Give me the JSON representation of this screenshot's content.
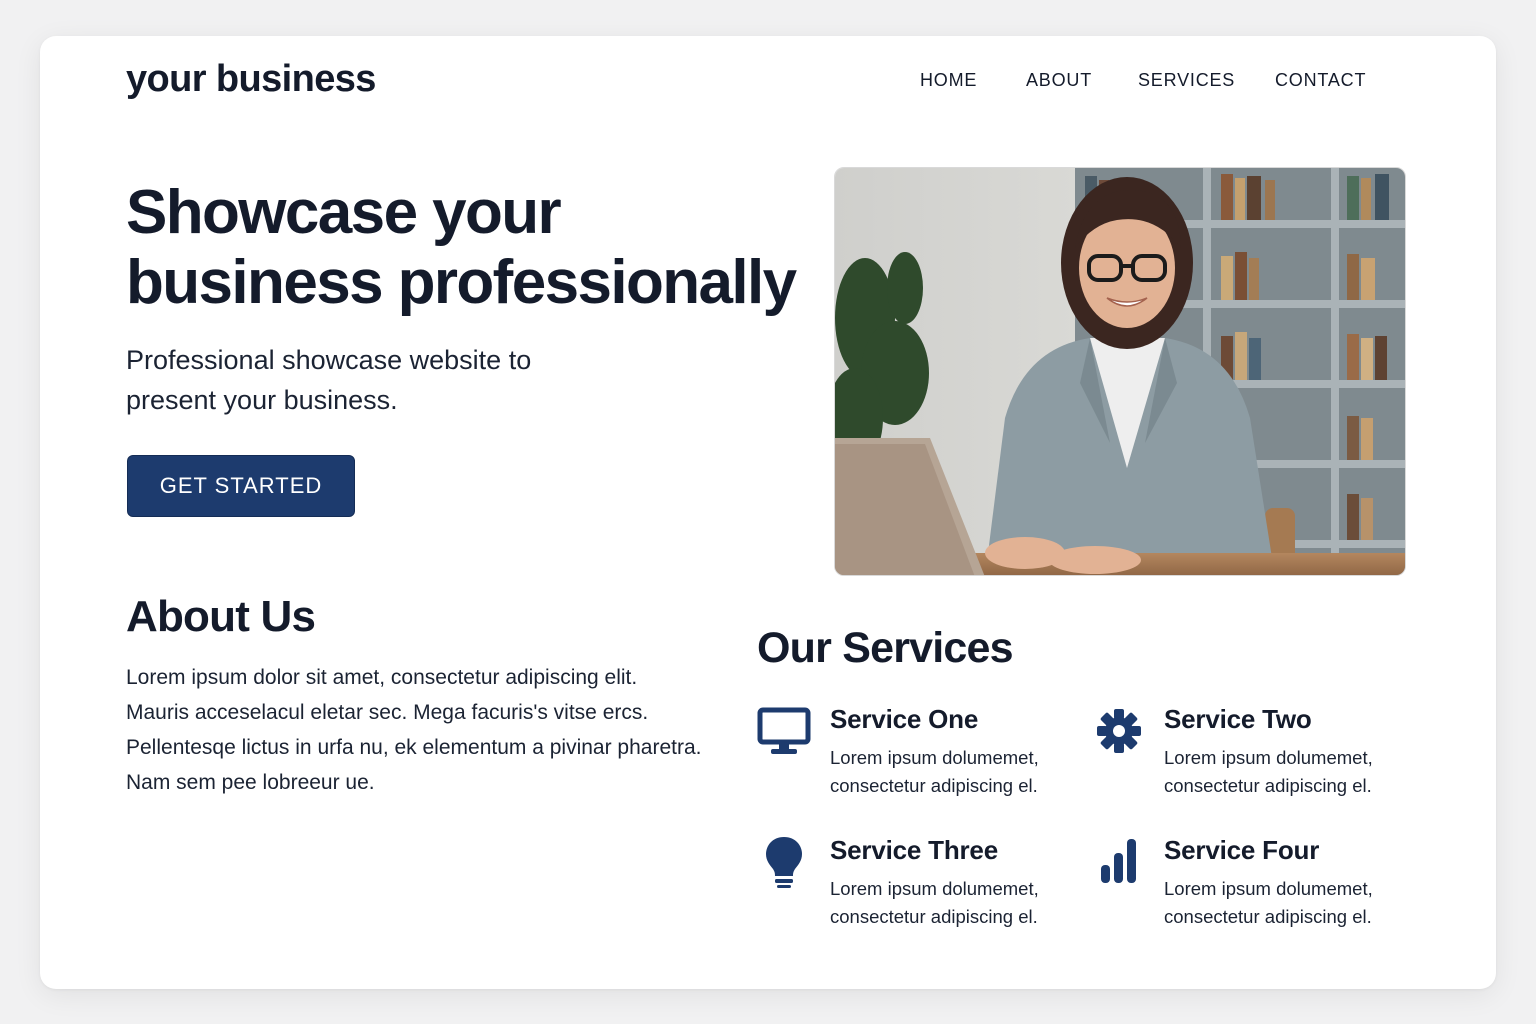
{
  "brand": {
    "logo": "your business",
    "accent_color": "#1d3b6e"
  },
  "nav": {
    "items": [
      {
        "label": "HOME"
      },
      {
        "label": "ABOUT"
      },
      {
        "label": "SERVICES"
      },
      {
        "label": "CONTACT"
      }
    ]
  },
  "hero": {
    "title_line1": "Showcase your",
    "title_line2": "business professionally",
    "subtitle": "Professional showcase website to present your business.",
    "cta_label": "GET STARTED"
  },
  "about": {
    "title": "About Us",
    "body": "Lorem ipsum dolor sit amet, consectetur adipiscing elit. Mauris acceselacul eletar sec. Mega facuris's vitse ercs. Pellentesqe lictus in urfa nu, ek elementum a pivinar pharetra. Nam sem pee lobreeur ue."
  },
  "services": {
    "title": "Our Services",
    "items": [
      {
        "name": "Service One",
        "desc": "Lorem ipsum dolumemet, consectetur adipiscing el.",
        "icon": "monitor-icon"
      },
      {
        "name": "Service Two",
        "desc": "Lorem ipsum dolumemet, consectetur adipiscing el.",
        "icon": "gear-icon"
      },
      {
        "name": "Service Three",
        "desc": "Lorem ipsum dolumemet, consectetur adipiscing el.",
        "icon": "lightbulb-icon"
      },
      {
        "name": "Service Four",
        "desc": "Lorem ipsum dolumemet, consectetur adipiscing el.",
        "icon": "bar-chart-icon"
      }
    ]
  }
}
